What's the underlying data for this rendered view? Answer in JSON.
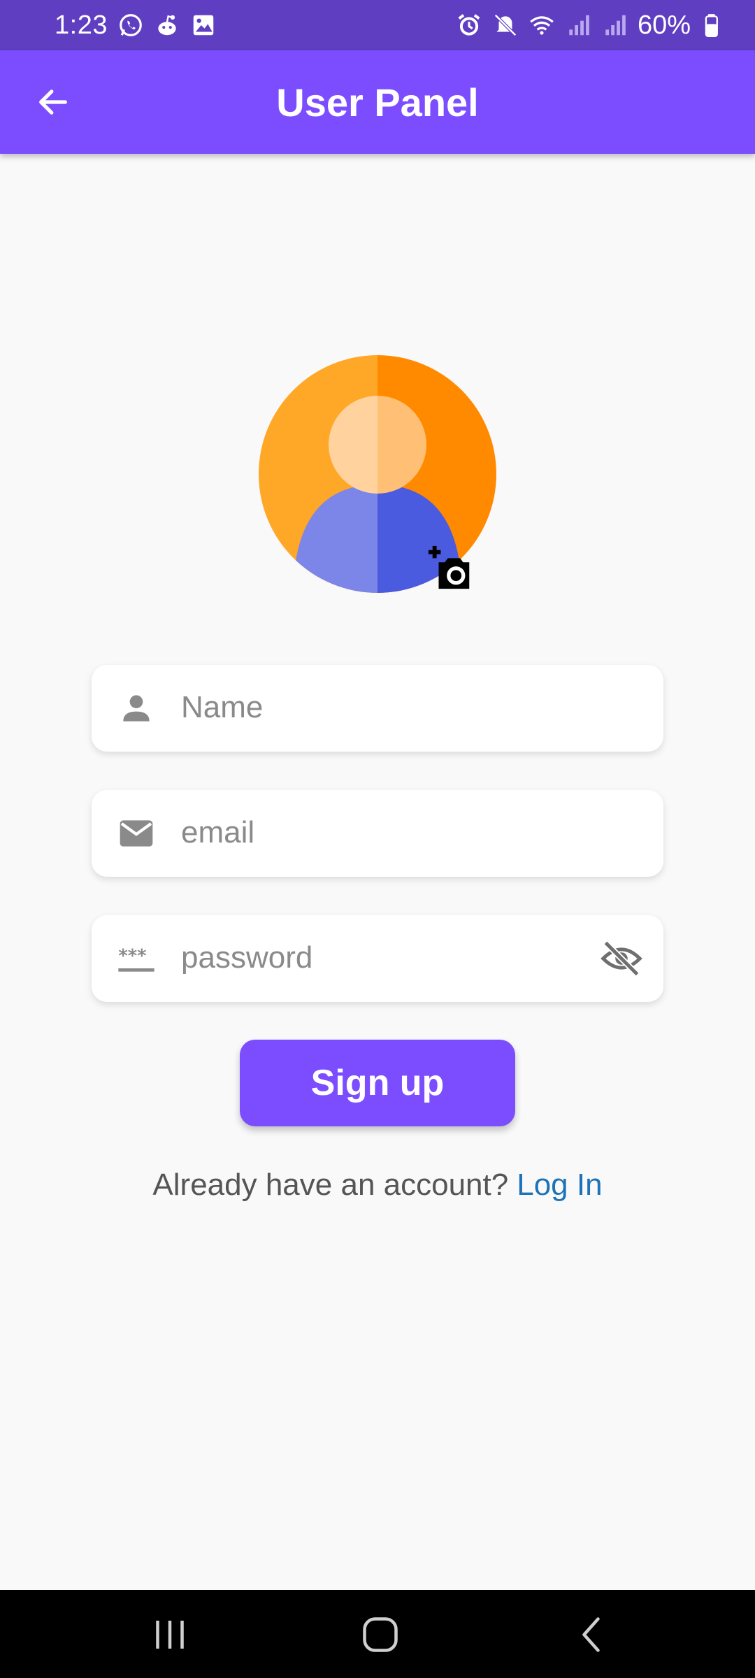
{
  "status_bar": {
    "time": "1:23",
    "left_icons": [
      "whatsapp-icon",
      "reddit-icon",
      "gallery-icon"
    ],
    "right_icons": [
      "alarm-icon",
      "mute-icon",
      "wifi-icon",
      "signal-icon",
      "signal-icon",
      "battery-icon"
    ],
    "battery": "60%"
  },
  "app_bar": {
    "back_icon": "arrow-left-icon",
    "title": "User Panel"
  },
  "avatar": {
    "icon": "person-avatar-icon",
    "add_photo_icon": "add-a-photo-icon"
  },
  "form": {
    "name": {
      "icon": "person-icon",
      "placeholder": "Name",
      "value": ""
    },
    "email": {
      "icon": "mail-icon",
      "placeholder": "email",
      "value": ""
    },
    "password": {
      "icon": "password-icon",
      "placeholder": "password",
      "value": "",
      "toggle_icon": "visibility-off-icon"
    }
  },
  "signup_button": {
    "label": "Sign up"
  },
  "login_prompt": {
    "text": "Already have an account?",
    "link": "Log In"
  },
  "colors": {
    "status_bar": "#5f3ec2",
    "primary": "#7c4dff",
    "link": "#1e73b8",
    "background": "#f9f9f9"
  },
  "nav_bar": {
    "items": [
      "recent-apps-icon",
      "home-icon",
      "back-icon"
    ]
  }
}
